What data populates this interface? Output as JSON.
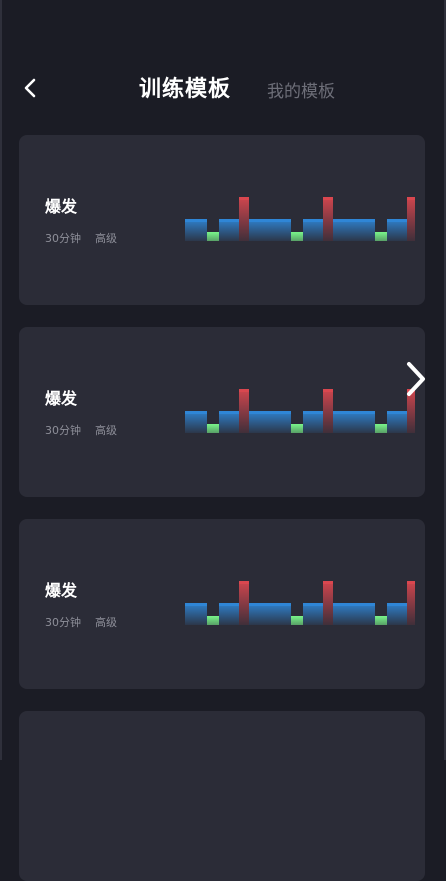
{
  "header": {
    "back_icon": "chevron-left-icon",
    "tabs": [
      {
        "label": "训练模板",
        "active": true
      },
      {
        "label": "我的模板",
        "active": false
      }
    ]
  },
  "templates": [
    {
      "title": "爆发",
      "duration": "30分钟",
      "level": "高级"
    },
    {
      "title": "爆发",
      "duration": "30分钟",
      "level": "高级"
    },
    {
      "title": "爆发",
      "duration": "30分钟",
      "level": "高级"
    },
    {
      "title": "",
      "duration": "",
      "level": ""
    }
  ],
  "next_icon": "chevron-right-icon",
  "colors": {
    "background": "#1b1c25",
    "card": "#2b2c37",
    "text_primary": "#ffffff",
    "text_secondary": "#8e8f99",
    "tab_inactive": "#6d6e78",
    "segment_blue": "#2f86d6",
    "segment_red": "#d9474f",
    "segment_green": "#7dff8e"
  }
}
